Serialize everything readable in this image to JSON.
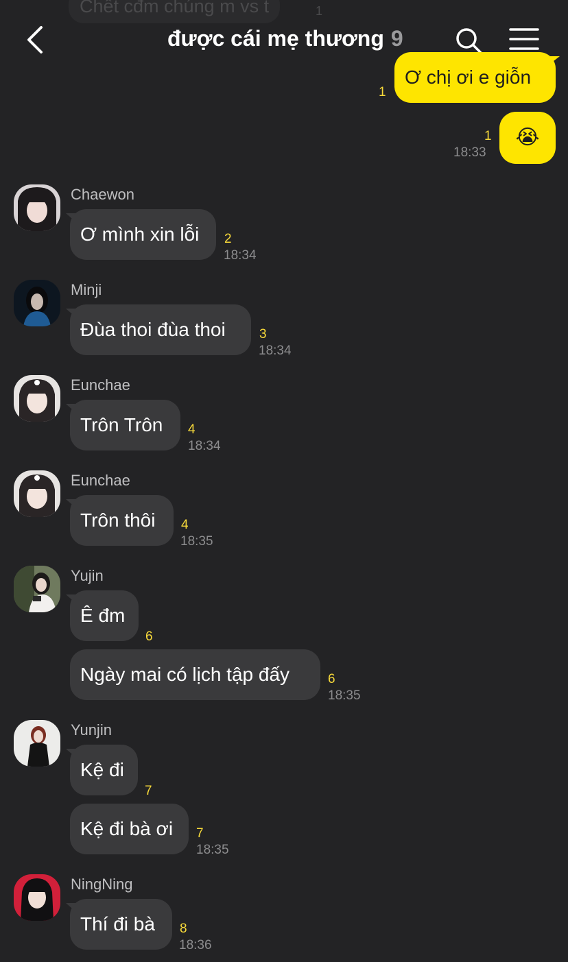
{
  "header": {
    "title": "được cái mẹ thương",
    "member_count": "9",
    "ghost_message": "Chết cđm chúng m vs t",
    "ghost_unread": "1"
  },
  "messages": [
    {
      "id": "m1",
      "sender": "",
      "text": "Ơ chị ơi e giỗn",
      "unread": "1",
      "time": "",
      "mine": true
    },
    {
      "id": "m2",
      "sender": "",
      "text": "😭",
      "unread": "1",
      "time": "18:33",
      "mine": true
    },
    {
      "id": "m3",
      "sender": "Chaewon",
      "text": "Ơ mình xin lỗi",
      "unread": "2",
      "time": "18:34"
    },
    {
      "id": "m4",
      "sender": "Minji",
      "text": "Đùa thoi đùa thoi",
      "unread": "3",
      "time": "18:34"
    },
    {
      "id": "m5",
      "sender": "Eunchae",
      "text": "Trôn Trôn",
      "unread": "4",
      "time": "18:34"
    },
    {
      "id": "m6",
      "sender": "Eunchae",
      "text": "Trôn thôi",
      "unread": "4",
      "time": "18:35"
    },
    {
      "id": "m7",
      "sender": "Yujin",
      "text": "Ê đm",
      "unread": "6",
      "time": ""
    },
    {
      "id": "m8",
      "sender": "",
      "text": "Ngày mai có lịch tập đấy",
      "unread": "6",
      "time": "18:35"
    },
    {
      "id": "m9",
      "sender": "Yunjin",
      "text": "Kệ đi",
      "unread": "7",
      "time": ""
    },
    {
      "id": "m10",
      "sender": "",
      "text": "Kệ đi bà ơi",
      "unread": "7",
      "time": "18:35"
    },
    {
      "id": "m11",
      "sender": "NingNing",
      "text": "Thí đi bà",
      "unread": "8",
      "time": "18:36"
    }
  ],
  "colors": {
    "background": "#232325",
    "bubble_other": "#3a3a3c",
    "bubble_mine": "#fee500",
    "unread": "#f7d93a",
    "time": "#8c8c8e"
  },
  "icons": [
    "chevron-left-icon",
    "search-icon",
    "menu-icon"
  ]
}
